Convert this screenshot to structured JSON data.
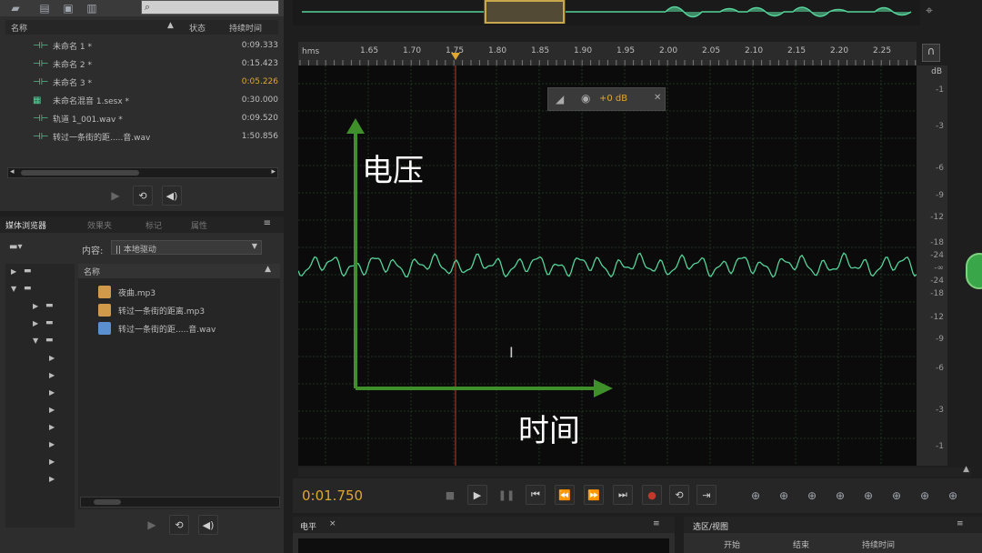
{
  "files_panel": {
    "col_name": "名称",
    "col_status": "状态",
    "col_duration": "持续时间",
    "items": [
      {
        "name": "未命名 1 *",
        "duration": "0:09.333",
        "icon": "waveform-icon",
        "highlight": false
      },
      {
        "name": "未命名 2 *",
        "duration": "0:15.423",
        "icon": "waveform-icon",
        "highlight": false
      },
      {
        "name": "未命名 3 *",
        "duration": "0:05.226",
        "icon": "waveform-icon",
        "highlight": true
      },
      {
        "name": "未命名混音 1.sesx *",
        "duration": "0:30.000",
        "icon": "multitrack-icon",
        "highlight": false
      },
      {
        "name": "轨道 1_001.wav *",
        "duration": "0:09.520",
        "icon": "waveform-icon",
        "highlight": false
      },
      {
        "name": "转过一条街的距.....音.wav",
        "duration": "1:50.856",
        "icon": "waveform-icon",
        "highlight": false
      }
    ]
  },
  "browser_panel": {
    "tabs": [
      "媒体浏览器",
      "效果夹",
      "标记",
      "属性"
    ],
    "content_label": "内容:",
    "content_value": "|| 本地驱动",
    "col_name": "名称",
    "files": [
      {
        "name": "夜曲.mp3",
        "icon": "mp3-file-icon"
      },
      {
        "name": "转过一条街的距离.mp3",
        "icon": "mp3-file-icon"
      },
      {
        "name": "转过一条街的距.....音.wav",
        "icon": "wav-file-icon"
      }
    ]
  },
  "ruler": {
    "unit": "hms",
    "labels": [
      "1.65",
      "1.70",
      "1.75",
      "1.80",
      "1.85",
      "1.90",
      "1.95",
      "2.00",
      "2.05",
      "2.10",
      "2.15",
      "2.20",
      "2.25"
    ]
  },
  "hud": {
    "gain": "+0 dB"
  },
  "db_scale": {
    "header": "dB",
    "labels": [
      "-1",
      "-3",
      "-6",
      "-9",
      "-12",
      "-18",
      "-24",
      "-∞",
      "-24",
      "-18",
      "-12",
      "-9",
      "-6",
      "-3",
      "-1"
    ]
  },
  "annotations": {
    "voltage": "电压",
    "time": "时间"
  },
  "transport": {
    "time": "0:01.750"
  },
  "bottom": {
    "level_tab": "电平",
    "selection_tab": "选区/视图",
    "col_start": "开始",
    "col_end": "结束",
    "col_duration": "持续时间"
  },
  "colors": {
    "accent": "#e0a630",
    "waveform": "#56d39a",
    "arrow": "#3f8f2a",
    "playhead": "#c0392b"
  }
}
